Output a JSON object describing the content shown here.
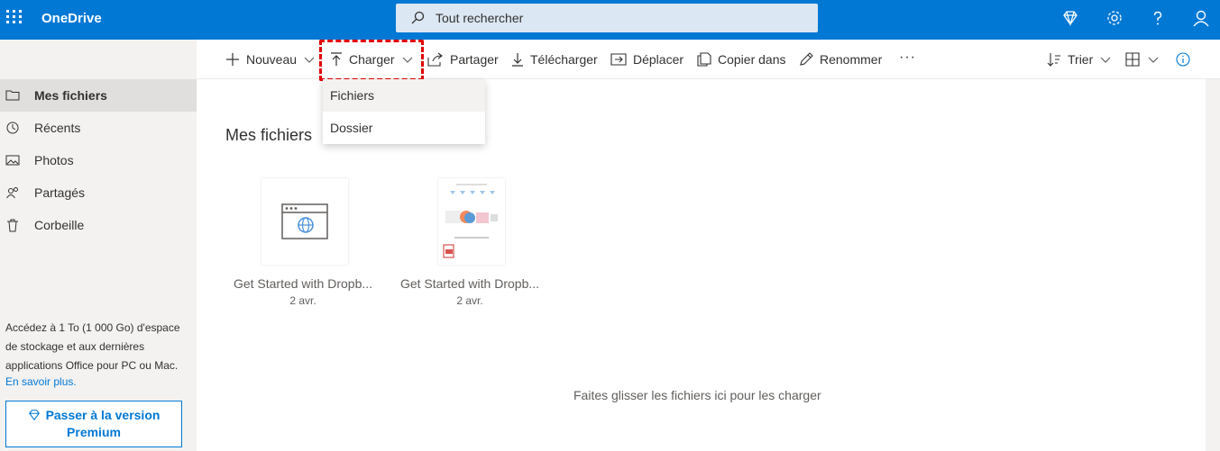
{
  "app": {
    "brand": "OneDrive"
  },
  "search": {
    "placeholder": "Tout rechercher"
  },
  "commands": {
    "new": "Nouveau",
    "upload": "Charger",
    "share": "Partager",
    "download": "Télécharger",
    "move": "Déplacer",
    "copy": "Copier dans",
    "rename": "Renommer",
    "more": "···",
    "sort": "Trier"
  },
  "upload_menu": {
    "items": [
      "Fichiers",
      "Dossier"
    ]
  },
  "sidebar": {
    "items": [
      {
        "label": "Mes fichiers",
        "icon": "folder-icon"
      },
      {
        "label": "Récents",
        "icon": "history-icon"
      },
      {
        "label": "Photos",
        "icon": "photo-icon"
      },
      {
        "label": "Partagés",
        "icon": "people-icon"
      },
      {
        "label": "Corbeille",
        "icon": "recycle-bin-icon"
      }
    ],
    "promo_text": "Accédez à 1 To (1 000 Go) d'espace de stockage et aux dernières applications Office pour PC ou Mac.",
    "promo_link": "En savoir plus.",
    "premium_line1": "Passer à la version",
    "premium_line2": "Premium"
  },
  "main": {
    "title": "Mes fichiers",
    "files": [
      {
        "name": "Get Started with Dropb...",
        "date": "2 avr."
      },
      {
        "name": "Get Started with Dropb...",
        "date": "2 avr."
      }
    ],
    "dropzone": "Faites glisser les fichiers ici pour les charger"
  },
  "colors": {
    "brand": "#0078d4",
    "highlight": "#e00000"
  }
}
